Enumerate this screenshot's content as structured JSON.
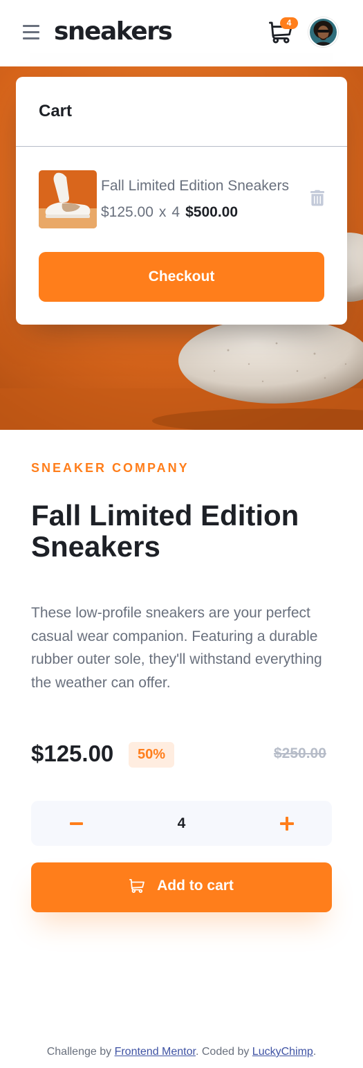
{
  "header": {
    "logo": "sneakers",
    "cart_count": "4"
  },
  "cart": {
    "title": "Cart",
    "item": {
      "name": "Fall Limited Edition Sneakers",
      "unit_price": "$125.00",
      "multiplier": "x",
      "quantity": "4",
      "total": "$500.00"
    },
    "checkout_label": "Checkout"
  },
  "product": {
    "company": "SNEAKER COMPANY",
    "title": "Fall Limited Edition Sneakers",
    "description": "These low-profile sneakers are your perfect casual wear companion. Featuring a durable rubber outer sole, they'll withstand everything the weather can offer.",
    "price": "$125.00",
    "discount": "50%",
    "original_price": "$250.00",
    "quantity": "4",
    "add_to_cart_label": "Add to cart"
  },
  "footer": {
    "prefix": "Challenge by ",
    "link1": "Frontend Mentor",
    "middle": ". Coded by ",
    "link2": "LuckyChimp",
    "suffix": "."
  },
  "colors": {
    "accent": "#ff7e1b",
    "accent_pale": "#ffede0",
    "dark": "#1d2026",
    "grey": "#69707d",
    "light_grey": "#b6bcc8",
    "qty_bg": "#f6f8fd",
    "hero_bg": "#d9661c"
  },
  "icons": [
    "menu-icon",
    "cart-icon",
    "avatar",
    "delete-icon",
    "minus-icon",
    "plus-icon"
  ]
}
